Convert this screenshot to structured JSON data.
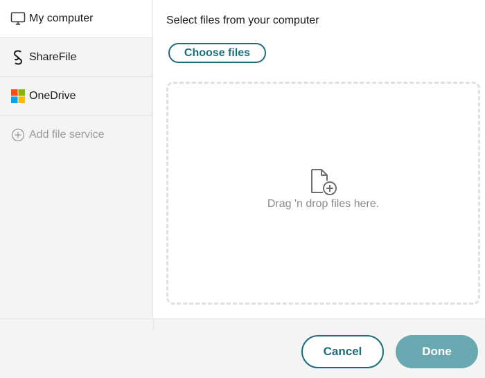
{
  "sidebar": {
    "items": [
      {
        "label": "My computer",
        "icon": "monitor-icon",
        "active": true
      },
      {
        "label": "ShareFile",
        "icon": "sharefile-logo-icon",
        "active": false
      },
      {
        "label": "OneDrive",
        "icon": "onedrive-logo-icon",
        "active": false
      },
      {
        "label": "Add file service",
        "icon": "plus-circle-icon",
        "active": false
      }
    ]
  },
  "main": {
    "title": "Select files from your computer",
    "choose_label": "Choose files",
    "drop_icon": "file-add-icon",
    "drop_text": "Drag 'n drop files here."
  },
  "footer": {
    "cancel_label": "Cancel",
    "done_label": "Done"
  },
  "colors": {
    "accent": "#1b6f7a",
    "done_disabled": "#6aa9b1",
    "sidebar_bg": "#f4f4f4",
    "microsoft_red": "#f25022",
    "microsoft_green": "#7fba00",
    "microsoft_blue": "#00a4ef",
    "microsoft_yellow": "#ffb900"
  }
}
